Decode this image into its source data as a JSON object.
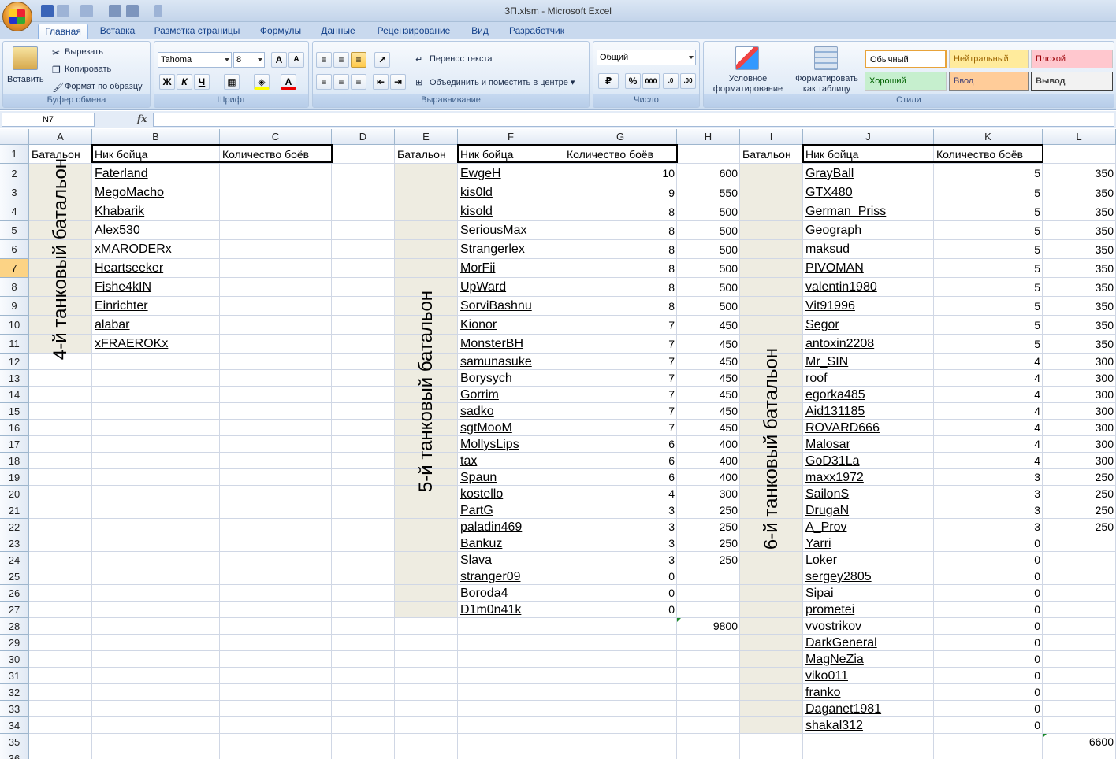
{
  "window": {
    "title": "ЗП.xlsm - Microsoft Excel"
  },
  "tabs": [
    "Главная",
    "Вставка",
    "Разметка страницы",
    "Формулы",
    "Данные",
    "Рецензирование",
    "Вид",
    "Разработчик"
  ],
  "ribbon": {
    "clipboard": {
      "label": "Буфер обмена",
      "paste": "Вставить",
      "cut": "Вырезать",
      "copy": "Копировать",
      "format_painter": "Формат по образцу"
    },
    "font": {
      "label": "Шрифт",
      "name": "Tahoma",
      "size": "8",
      "bold": "Ж",
      "italic": "К",
      "underline": "Ч"
    },
    "alignment": {
      "label": "Выравнивание",
      "wrap": "Перенос текста",
      "merge": "Объединить и поместить в центре"
    },
    "number": {
      "label": "Число",
      "format": "Общий",
      "percent": "%",
      "thousands": "000"
    },
    "styles": {
      "label": "Стили",
      "conditional": "Условное форматирование",
      "as_table": "Форматировать как таблицу",
      "normal": "Обычный",
      "neutral": "Нейтральный",
      "bad": "Плохой",
      "good": "Хороший",
      "input": "Ввод",
      "output": "Вывод"
    }
  },
  "formula_bar": {
    "name_box": "N7",
    "fx": "fx",
    "value": ""
  },
  "columns": [
    "A",
    "B",
    "C",
    "D",
    "E",
    "F",
    "G",
    "H",
    "I",
    "J",
    "K",
    "L"
  ],
  "rows": [
    "1",
    "2",
    "3",
    "4",
    "5",
    "6",
    "7",
    "8",
    "9",
    "10",
    "11",
    "12",
    "13",
    "14",
    "15",
    "16",
    "17",
    "18",
    "19",
    "20",
    "21",
    "22",
    "23",
    "24",
    "25",
    "26",
    "27",
    "28",
    "29",
    "30",
    "31",
    "32",
    "33",
    "34",
    "35",
    "36"
  ],
  "headers": {
    "battalion": "Батальон",
    "nick": "Ник бойца",
    "battles": "Количество боёв"
  },
  "bat4": {
    "label": "4-й танковый батальон",
    "players": [
      " Faterland",
      " MegoMacho",
      " Khabarik",
      "Alex530",
      "xMARODERx",
      "Heartseeker",
      "Fishe4kIN",
      "Einrichter",
      "alabar",
      " xFRAEROKx"
    ]
  },
  "bat5": {
    "label": "5-й танковый батальон",
    "players": [
      {
        "nick": " EwgeH",
        "battles": "10",
        "pay": "600"
      },
      {
        "nick": " kis0ld",
        "battles": "9",
        "pay": "550"
      },
      {
        "nick": "kisold",
        "battles": "8",
        "pay": "500"
      },
      {
        "nick": " SeriousMax",
        "battles": "8",
        "pay": "500"
      },
      {
        "nick": "Strangerlex",
        "battles": "8",
        "pay": "500"
      },
      {
        "nick": " MorFii",
        "battles": "8",
        "pay": "500"
      },
      {
        "nick": "UpWard",
        "battles": "8",
        "pay": "500"
      },
      {
        "nick": "SorviBashnu",
        "battles": "8",
        "pay": "500"
      },
      {
        "nick": "Kionor",
        "battles": "7",
        "pay": "450"
      },
      {
        "nick": "MonsterBH",
        "battles": "7",
        "pay": "450"
      },
      {
        "nick": "samunasuke",
        "battles": "7",
        "pay": "450"
      },
      {
        "nick": " Borysych",
        "battles": "7",
        "pay": "450"
      },
      {
        "nick": " Gorrim",
        "battles": "7",
        "pay": "450"
      },
      {
        "nick": "sadko",
        "battles": "7",
        "pay": "450"
      },
      {
        "nick": "sgtMooM",
        "battles": "7",
        "pay": "450"
      },
      {
        "nick": "MollysLips",
        "battles": "6",
        "pay": "400"
      },
      {
        "nick": " tax",
        "battles": "6",
        "pay": "400"
      },
      {
        "nick": " Spaun",
        "battles": "6",
        "pay": "400"
      },
      {
        "nick": " kostello",
        "battles": "4",
        "pay": "300"
      },
      {
        "nick": " PartG",
        "battles": "3",
        "pay": "250"
      },
      {
        "nick": " paladin469",
        "battles": "3",
        "pay": "250"
      },
      {
        "nick": "Bankuz",
        "battles": "3",
        "pay": "250"
      },
      {
        "nick": "Slava",
        "battles": "3",
        "pay": "250"
      },
      {
        "nick": " stranger09",
        "battles": "0",
        "pay": ""
      },
      {
        "nick": " Boroda4",
        "battles": "0",
        "pay": ""
      },
      {
        "nick": " D1m0n41k",
        "battles": "0",
        "pay": ""
      }
    ],
    "total": "9800"
  },
  "bat6": {
    "label": "6-й танковый батальон",
    "players": [
      {
        "nick": " GrayBall",
        "battles": "5",
        "pay": "350"
      },
      {
        "nick": "GTX480",
        "battles": "5",
        "pay": "350"
      },
      {
        "nick": " German_Priss",
        "battles": "5",
        "pay": "350"
      },
      {
        "nick": "Geograph",
        "battles": "5",
        "pay": "350"
      },
      {
        "nick": "maksud",
        "battles": "5",
        "pay": "350"
      },
      {
        "nick": "PIVOMAN",
        "battles": "5",
        "pay": "350"
      },
      {
        "nick": "valentin1980",
        "battles": "5",
        "pay": "350"
      },
      {
        "nick": "Vit91996",
        "battles": "5",
        "pay": "350"
      },
      {
        "nick": "Segor",
        "battles": "5",
        "pay": "350"
      },
      {
        "nick": " antoxin2208",
        "battles": "5",
        "pay": "350"
      },
      {
        "nick": " Mr_SIN",
        "battles": "4",
        "pay": "300"
      },
      {
        "nick": " roof",
        "battles": "4",
        "pay": "300"
      },
      {
        "nick": " egorka485",
        "battles": "4",
        "pay": "300"
      },
      {
        "nick": " Aid131185",
        "battles": "4",
        "pay": "300"
      },
      {
        "nick": "ROVARD666",
        "battles": "4",
        "pay": "300"
      },
      {
        "nick": "Malosar",
        "battles": "4",
        "pay": "300"
      },
      {
        "nick": "GoD31La",
        "battles": "4",
        "pay": "300"
      },
      {
        "nick": " maxx1972",
        "battles": "3",
        "pay": "250"
      },
      {
        "nick": "SailonS",
        "battles": "3",
        "pay": "250"
      },
      {
        "nick": "DrugaN",
        "battles": "3",
        "pay": "250"
      },
      {
        "nick": "A_Prov",
        "battles": "3",
        "pay": "250"
      },
      {
        "nick": " Yarri",
        "battles": "0",
        "pay": ""
      },
      {
        "nick": "Loker",
        "battles": "0",
        "pay": ""
      },
      {
        "nick": "sergey2805",
        "battles": "0",
        "pay": ""
      },
      {
        "nick": " Sipai",
        "battles": "0",
        "pay": ""
      },
      {
        "nick": " prometei",
        "battles": "0",
        "pay": ""
      },
      {
        "nick": "vvostrikov",
        "battles": "0",
        "pay": ""
      },
      {
        "nick": " DarkGeneral",
        "battles": "0",
        "pay": ""
      },
      {
        "nick": "MagNeZia",
        "battles": "0",
        "pay": ""
      },
      {
        "nick": "viko011",
        "battles": "0",
        "pay": ""
      },
      {
        "nick": "franko",
        "battles": "0",
        "pay": ""
      },
      {
        "nick": "Daganet1981",
        "battles": "0",
        "pay": ""
      },
      {
        "nick": " shakal312",
        "battles": "0",
        "pay": ""
      }
    ],
    "total": "6600"
  }
}
